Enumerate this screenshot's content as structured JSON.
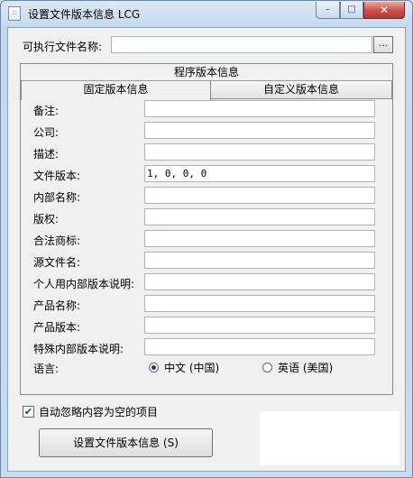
{
  "window": {
    "title": "设置文件版本信息 LCG",
    "icon_text": "∴"
  },
  "exe": {
    "label": "可执行文件名称:",
    "value": "",
    "browse_label": "..."
  },
  "tabs": {
    "group_title": "程序版本信息",
    "fixed": "固定版本信息",
    "custom": "自定义版本信息"
  },
  "fields": [
    {
      "label": "备注:",
      "value": ""
    },
    {
      "label": "公司:",
      "value": ""
    },
    {
      "label": "描述:",
      "value": ""
    },
    {
      "label": "文件版本:",
      "value": "1, 0, 0, 0"
    },
    {
      "label": "内部名称:",
      "value": ""
    },
    {
      "label": "版权:",
      "value": ""
    },
    {
      "label": "合法商标:",
      "value": ""
    },
    {
      "label": "源文件名:",
      "value": ""
    },
    {
      "label": "个人用内部版本说明:",
      "value": ""
    },
    {
      "label": "产品名称:",
      "value": ""
    },
    {
      "label": "产品版本:",
      "value": ""
    },
    {
      "label": "特殊内部版本说明:",
      "value": ""
    }
  ],
  "language": {
    "label": "语言:",
    "options": [
      {
        "label": "中文 (中国)",
        "selected": true
      },
      {
        "label": "英语 (美国)",
        "selected": false
      }
    ]
  },
  "auto_ignore": {
    "label": "自动忽略内容为空的项目",
    "checked": true,
    "check_glyph": "✔"
  },
  "actions": {
    "set_button": "设置文件版本信息 (S)"
  }
}
